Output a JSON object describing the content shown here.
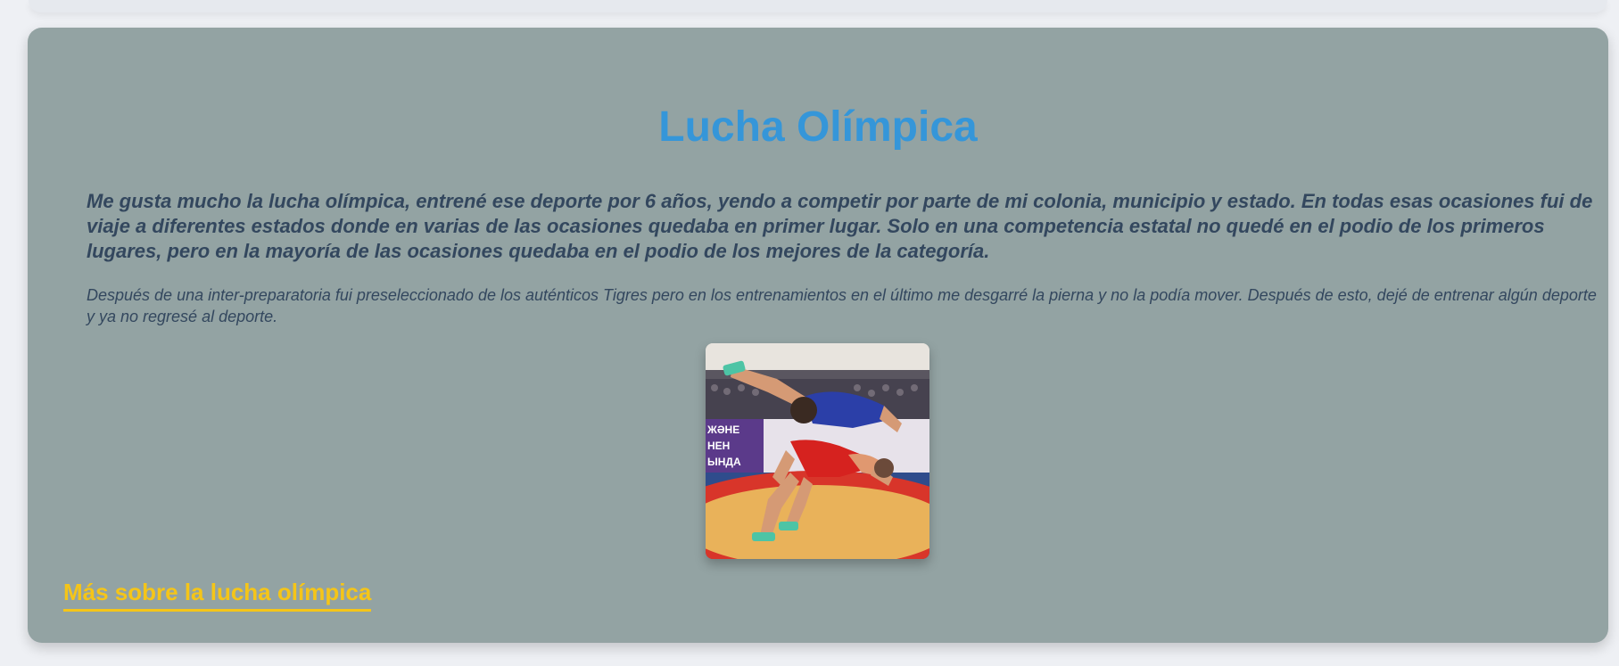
{
  "section": {
    "title": "Lucha Olímpica",
    "intro": "Me gusta mucho la lucha olímpica, entrené ese deporte por 6 años, yendo a competir por parte de mi colonia, municipio y estado. En todas esas ocasiones fui de viaje a diferentes estados donde en varias de las ocasiones quedaba en primer lugar. Solo en una competencia estatal no quedé en el podio de los primeros lugares, pero en la mayoría de las ocasiones quedaba en el podio de los mejores de la categoría.",
    "secondary": "Después de una inter-preparatoria fui preseleccionado de los auténticos Tigres pero en los entrenamientos en el último me desgarré la pierna y no la podía mover. Después de esto, dejé de entrenar algún deporte y ya no regresé al deporte.",
    "photo": {
      "banner_lines": [
        "ЖӘНЕ",
        "НЕН",
        "ЫНДА"
      ]
    },
    "more_link": "Más sobre la lucha olímpica"
  },
  "colors": {
    "card_background": "#93a3a3",
    "title": "#3596d9",
    "body_text": "#33475e",
    "link": "#f5c518"
  }
}
